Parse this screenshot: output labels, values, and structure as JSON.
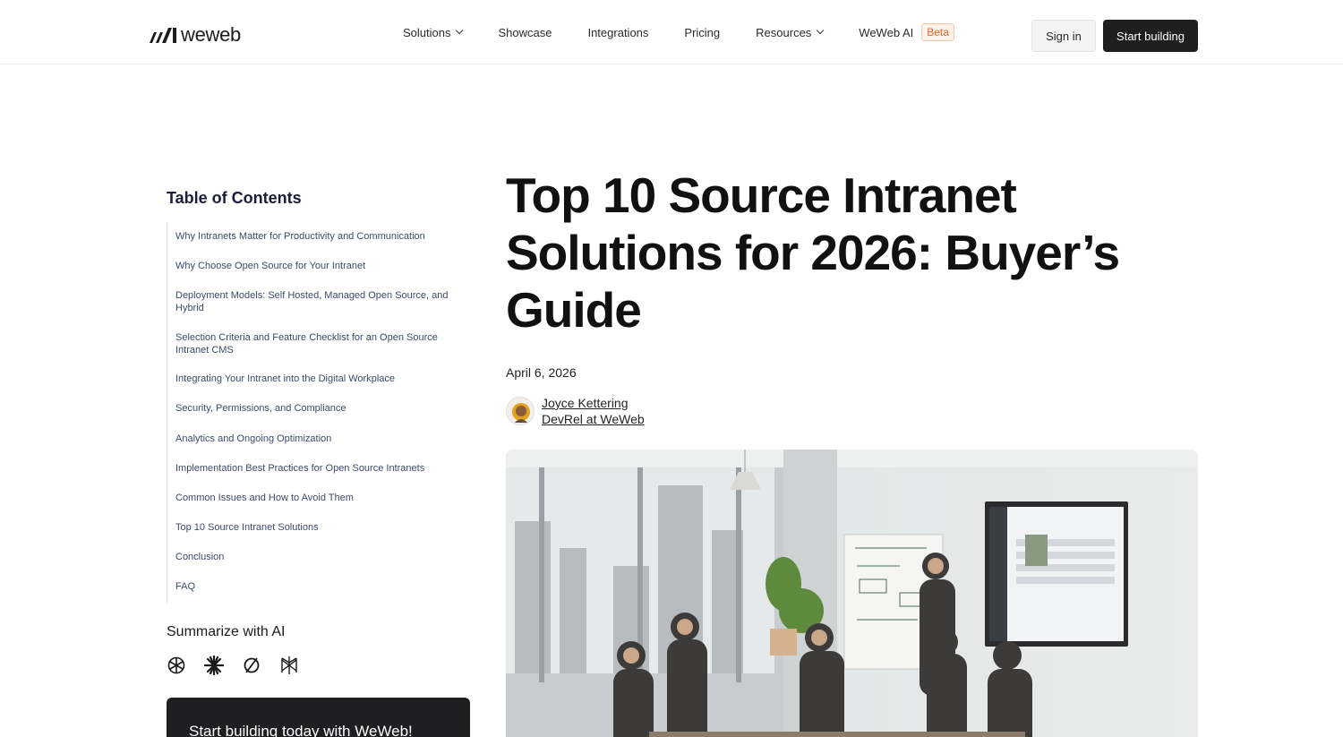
{
  "header": {
    "logo_text": "weweb",
    "nav": [
      {
        "label": "Solutions",
        "dropdown": true
      },
      {
        "label": "Showcase",
        "dropdown": false
      },
      {
        "label": "Integrations",
        "dropdown": false
      },
      {
        "label": "Pricing",
        "dropdown": false
      },
      {
        "label": "Resources",
        "dropdown": true
      },
      {
        "label": "WeWeb AI",
        "dropdown": false,
        "badge": "Beta"
      }
    ],
    "sign_in": "Sign in",
    "start_building": "Start building"
  },
  "sidebar": {
    "toc_title": "Table of Contents",
    "toc_items": [
      "Why Intranets Matter for Productivity and Communication",
      "Why Choose Open Source for Your Intranet",
      "Deployment Models: Self Hosted, Managed Open Source, and Hybrid",
      "Selection Criteria and Feature Checklist for an Open Source Intranet CMS",
      "Integrating Your Intranet into the Digital Workplace",
      "Security, Permissions, and Compliance",
      "Analytics and Ongoing Optimization",
      "Implementation Best Practices for Open Source Intranets",
      "Common Issues and How to Avoid Them",
      "Top 10 Source Intranet Solutions",
      "Conclusion",
      "FAQ"
    ],
    "summarize_title": "Summarize with AI",
    "ai_icons": [
      "chatgpt-icon",
      "claude-icon",
      "perplexity-icon",
      "grok-icon"
    ],
    "cta_text": "Start building today with WeWeb!"
  },
  "article": {
    "title": "Top 10 Source Intranet Solutions for 2026: Buyer’s Guide",
    "date": "April 6, 2026",
    "author_name": "Joyce Kettering",
    "author_role": "DevRel at WeWeb",
    "hero_alt": "Team meeting in office with presentation on wall-mounted screen"
  },
  "colors": {
    "accent_dark": "#1f1f1f",
    "beta_orange": "#e8662b",
    "toc_link": "#3b4a6b"
  }
}
